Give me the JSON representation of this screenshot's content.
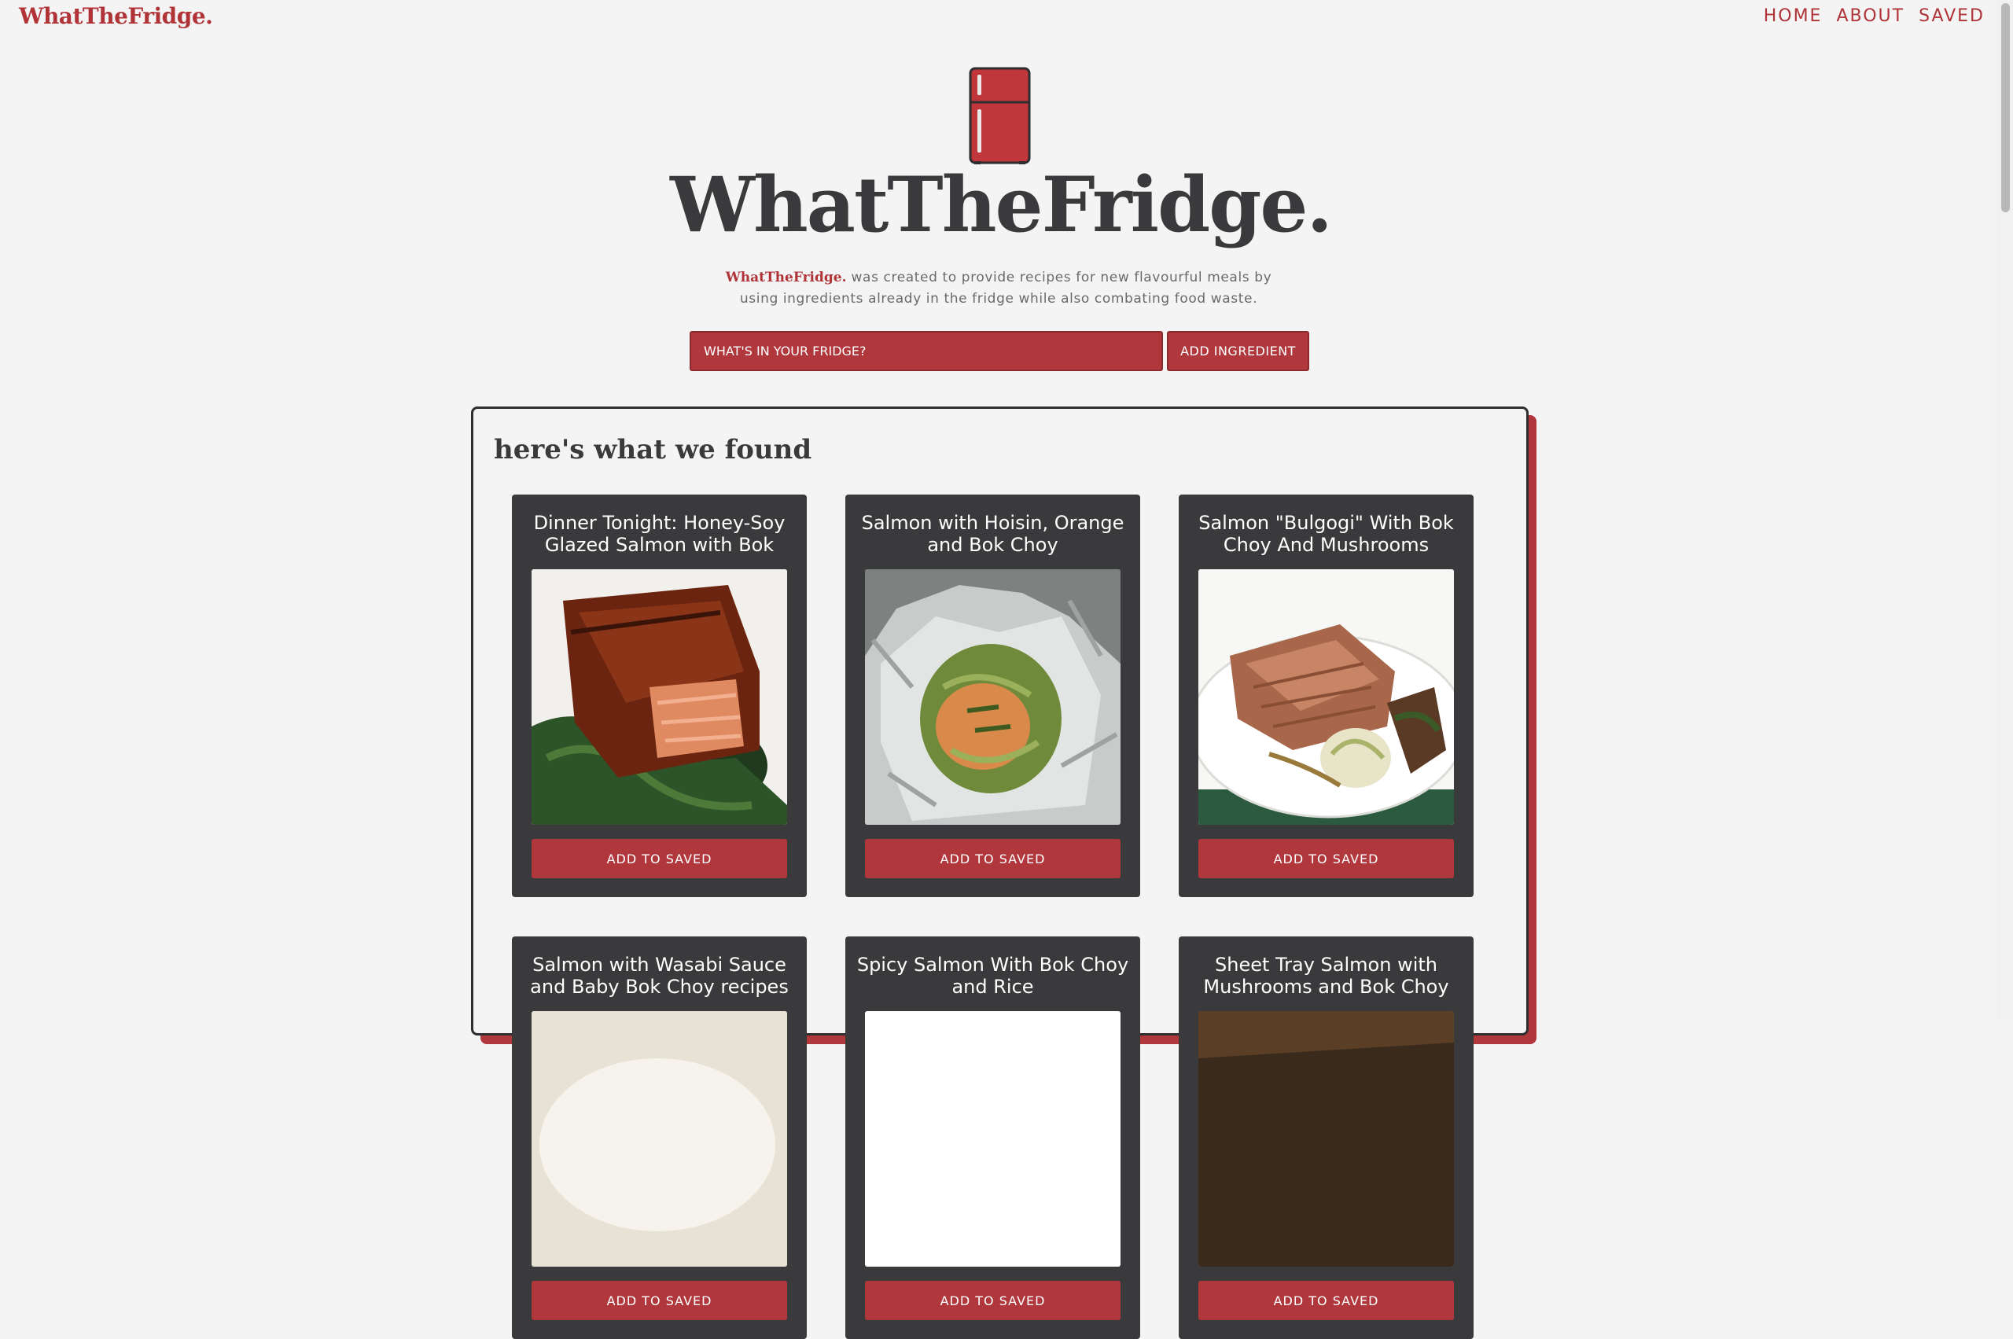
{
  "header": {
    "brand": "WhatTheFridge.",
    "nav": [
      {
        "label": "HOME"
      },
      {
        "label": "ABOUT"
      },
      {
        "label": "SAVED"
      }
    ]
  },
  "hero": {
    "title": "WhatTheFridge.",
    "brand_inline": "WhatTheFridge.",
    "description": "was created to provide recipes for new flavourful meals by using ingredients already in the fridge while also combating food waste."
  },
  "search": {
    "placeholder": "WHAT'S IN YOUR FRIDGE?",
    "add_label": "ADD INGREDIENT"
  },
  "results": {
    "heading": "here's what we found",
    "recipes": [
      {
        "title": "Dinner Tonight: Honey-Soy Glazed Salmon with Bok",
        "button": "ADD TO SAVED"
      },
      {
        "title": "Salmon with Hoisin, Orange and Bok Choy",
        "button": "ADD TO SAVED"
      },
      {
        "title": "Salmon \"Bulgogi\" With Bok Choy And Mushrooms",
        "button": "ADD TO SAVED"
      },
      {
        "title": "Salmon with Wasabi Sauce and Baby Bok Choy recipes",
        "button": "ADD TO SAVED"
      },
      {
        "title": "Spicy Salmon With Bok Choy and Rice",
        "button": "ADD TO SAVED"
      },
      {
        "title": "Sheet Tray Salmon with Mushrooms and Bok Choy",
        "button": "ADD TO SAVED"
      }
    ]
  },
  "colors": {
    "accent": "#b0373c",
    "dark": "#3a3a3c",
    "background": "#f4f4f4"
  }
}
